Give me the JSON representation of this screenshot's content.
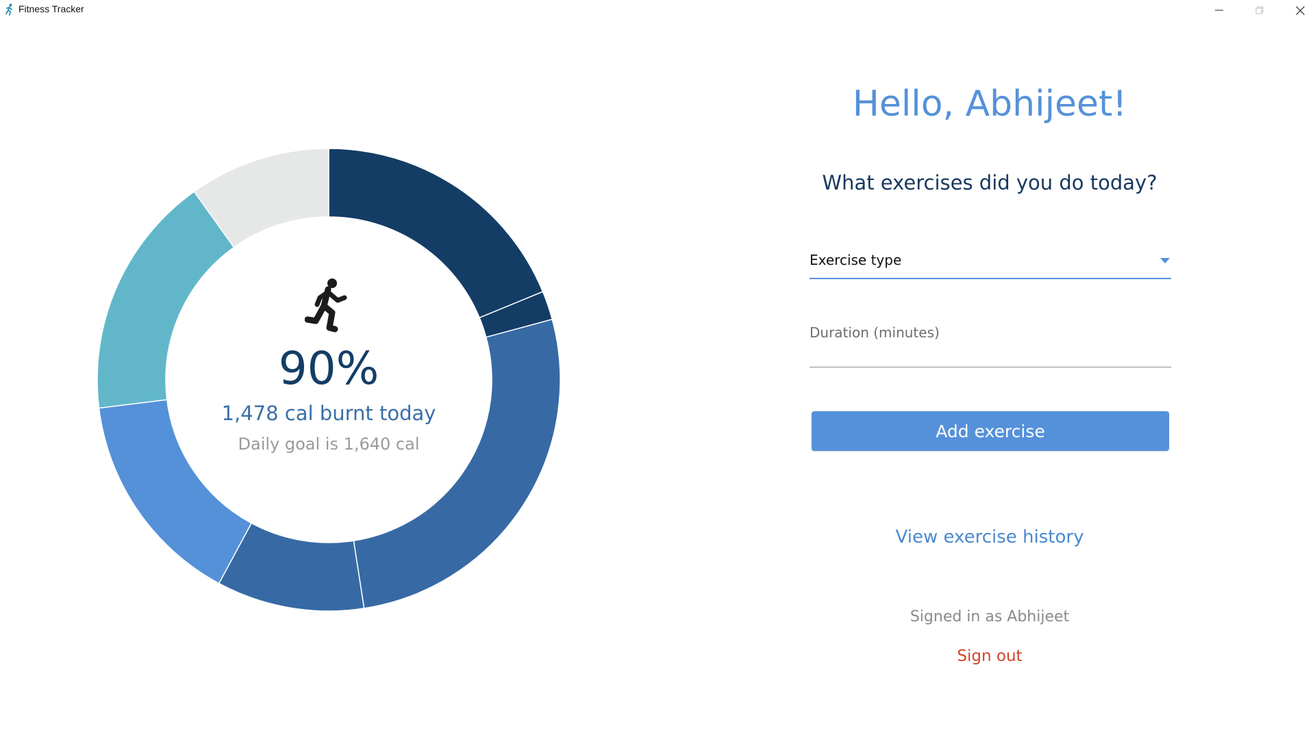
{
  "window": {
    "title": "Fitness Tracker",
    "controls": [
      "minimize",
      "maximize",
      "close"
    ]
  },
  "dashboard": {
    "percent_label": "90%",
    "burnt_label": "1,478 cal burnt today",
    "goal_label": "Daily goal is 1,640 cal",
    "icon": "running-person-icon"
  },
  "chart_data": {
    "type": "pie",
    "variant": "donut",
    "total_goal": 1640,
    "burnt_total": 1478,
    "percent": 90,
    "slices": [
      {
        "value": 308,
        "color": "#143d66"
      },
      {
        "value": 33,
        "color": "#143d66"
      },
      {
        "value": 439,
        "color": "#376aa4"
      },
      {
        "value": 169,
        "color": "#376aa4"
      },
      {
        "value": 249,
        "color": "#5591d9"
      },
      {
        "value": 280,
        "color": "#61b7c9"
      },
      {
        "value": 162,
        "color": "#e6e8e7"
      }
    ],
    "title": "",
    "legend": "none"
  },
  "form": {
    "greeting": "Hello, Abhijeet!",
    "question": "What exercises did you do today?",
    "exercise_type_label": "Exercise type",
    "duration_label": "Duration (minutes)",
    "add_button": "Add exercise",
    "history_link": "View exercise history",
    "signed_in": "Signed in as Abhijeet",
    "sign_out": "Sign out"
  },
  "colors": {
    "accent": "#5591d9",
    "dark_navy": "#143d66",
    "mid_blue": "#376aa4",
    "teal": "#61b7c9",
    "remaining": "#e6e8e7",
    "sign_out": "#d2452b"
  }
}
